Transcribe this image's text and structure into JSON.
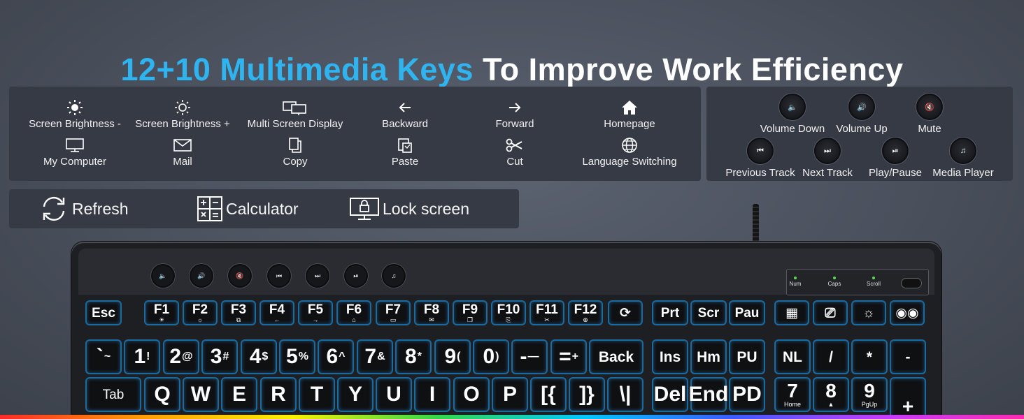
{
  "title": {
    "highlight": "12+10 Multimedia Keys",
    "rest": "To Improve Work Efficiency"
  },
  "colors": {
    "highlight": "#2fb4f0",
    "key_glow": "#1a6aa0",
    "indicator_led": "#55e04a"
  },
  "function_keys_panel": {
    "row1": [
      {
        "label": "Screen Brightness -",
        "icon": "sun-filled-icon"
      },
      {
        "label": "Screen Brightness +",
        "icon": "sun-outline-icon"
      },
      {
        "label": "Multi Screen Display",
        "icon": "multi-screen-icon"
      },
      {
        "label": "Backward",
        "icon": "arrow-left-icon"
      },
      {
        "label": "Forward",
        "icon": "arrow-right-icon"
      },
      {
        "label": "Homepage",
        "icon": "home-icon"
      }
    ],
    "row2": [
      {
        "label": "My Computer",
        "icon": "monitor-icon"
      },
      {
        "label": "Mail",
        "icon": "mail-icon"
      },
      {
        "label": "Copy",
        "icon": "copy-icon"
      },
      {
        "label": "Paste",
        "icon": "paste-icon"
      },
      {
        "label": "Cut",
        "icon": "scissors-icon"
      },
      {
        "label": "Language Switching",
        "icon": "globe-icon"
      }
    ]
  },
  "media_keys_panel": {
    "row1": [
      {
        "label": "Volume Down",
        "glyph": "🔈"
      },
      {
        "label": "Volume Up",
        "glyph": "🔊"
      },
      {
        "label": "Mute",
        "glyph": "🔇"
      }
    ],
    "row2": [
      {
        "label": "Previous Track",
        "glyph": "⏮"
      },
      {
        "label": "Next Track",
        "glyph": "⏭"
      },
      {
        "label": "Play/Pause",
        "glyph": "⏯"
      },
      {
        "label": "Media Player",
        "glyph": "♫"
      }
    ]
  },
  "extra_keys_panel": [
    {
      "label": "Refresh",
      "icon": "refresh-icon"
    },
    {
      "label": "Calculator",
      "icon": "calculator-icon"
    },
    {
      "label": "Lock screen",
      "icon": "lock-screen-icon"
    }
  ],
  "keyboard": {
    "indicators": [
      "Num",
      "Caps",
      "Scroll"
    ],
    "top_media_glyphs": [
      "🔈",
      "🔊",
      "🔇",
      "⏮",
      "⏭",
      "⏯",
      "♫"
    ],
    "fn_row": [
      {
        "main": "Esc",
        "sub": ""
      },
      {
        "main": "F1",
        "sub": "☀"
      },
      {
        "main": "F2",
        "sub": "☼"
      },
      {
        "main": "F3",
        "sub": "⧉"
      },
      {
        "main": "F4",
        "sub": "←"
      },
      {
        "main": "F5",
        "sub": "→"
      },
      {
        "main": "F6",
        "sub": "⌂"
      },
      {
        "main": "F7",
        "sub": "▭"
      },
      {
        "main": "F8",
        "sub": "✉"
      },
      {
        "main": "F9",
        "sub": "❐"
      },
      {
        "main": "F10",
        "sub": "⎘"
      },
      {
        "main": "F11",
        "sub": "✂"
      },
      {
        "main": "F12",
        "sub": "⊕"
      },
      {
        "main": "⟳",
        "sub": ""
      },
      {
        "main": "Prt",
        "sub": ""
      },
      {
        "main": "Scr",
        "sub": ""
      },
      {
        "main": "Pau",
        "sub": ""
      },
      {
        "main": "▦",
        "sub": ""
      },
      {
        "main": "⎚",
        "sub": ""
      },
      {
        "main": "☼",
        "sub": ""
      },
      {
        "main": "◉◉",
        "sub": ""
      }
    ],
    "number_row": [
      {
        "main": "`",
        "sup": "~"
      },
      {
        "main": "1",
        "sup": "!"
      },
      {
        "main": "2",
        "sup": "@"
      },
      {
        "main": "3",
        "sup": "#"
      },
      {
        "main": "4",
        "sup": "$"
      },
      {
        "main": "5",
        "sup": "%"
      },
      {
        "main": "6",
        "sup": "^"
      },
      {
        "main": "7",
        "sup": "&"
      },
      {
        "main": "8",
        "sup": "*"
      },
      {
        "main": "9",
        "sup": "("
      },
      {
        "main": "0",
        "sup": ")"
      },
      {
        "main": "-",
        "sup": "—"
      },
      {
        "main": "=",
        "sup": "+"
      }
    ],
    "number_row_right": [
      "Back",
      "Ins",
      "Hm",
      "PU",
      "NL",
      "/",
      "*",
      "-"
    ],
    "qwerty_row": [
      "Tab",
      "Q",
      "W",
      "E",
      "R",
      "T",
      "Y",
      "U",
      "I",
      "O",
      "P",
      "[{",
      "]}",
      "\\|",
      "Del",
      "End",
      "PD"
    ],
    "numpad_row3": [
      {
        "main": "7",
        "sub": "Home"
      },
      {
        "main": "8",
        "sub": "▲"
      },
      {
        "main": "9",
        "sub": "PgUp"
      },
      {
        "main": "+",
        "sub": ""
      }
    ]
  }
}
